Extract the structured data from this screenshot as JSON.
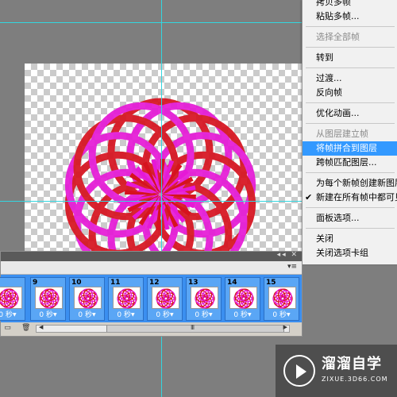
{
  "menu": {
    "items": [
      {
        "label": "拷贝多帧",
        "state": "normal"
      },
      {
        "label": "粘贴多帧...",
        "state": "normal"
      },
      {
        "label": "选择全部帧",
        "state": "disabled"
      },
      {
        "label": "转到",
        "state": "normal"
      },
      {
        "label": "过渡...",
        "state": "normal"
      },
      {
        "label": "反向帧",
        "state": "normal"
      },
      {
        "label": "优化动画...",
        "state": "normal"
      },
      {
        "label": "从图层建立帧",
        "state": "disabled"
      },
      {
        "label": "将帧拼合到图层",
        "state": "highlighted"
      },
      {
        "label": "跨帧匹配图层...",
        "state": "normal"
      },
      {
        "label": "为每个新帧创建新图层",
        "state": "normal"
      },
      {
        "label": "新建在所有帧中都可见",
        "state": "checked"
      },
      {
        "label": "面板选项...",
        "state": "normal"
      },
      {
        "label": "关闭",
        "state": "normal"
      },
      {
        "label": "关闭选项卡组",
        "state": "normal"
      }
    ],
    "check_glyph": "✔"
  },
  "animation_panel": {
    "collapse_glyph": "◂◂ ✕",
    "menu_glyph": "▾≡",
    "frames": [
      {
        "number": "",
        "delay": "0 秒"
      },
      {
        "number": "9",
        "delay": "0 秒"
      },
      {
        "number": "10",
        "delay": "0 秒"
      },
      {
        "number": "11",
        "delay": "0 秒"
      },
      {
        "number": "12",
        "delay": "0 秒"
      },
      {
        "number": "13",
        "delay": "0 秒"
      },
      {
        "number": "14",
        "delay": "0 秒"
      },
      {
        "number": "15",
        "delay": "0 秒"
      }
    ],
    "bottom_icons": [
      "new-frame-icon",
      "delete-frame-icon"
    ],
    "scroll_grip": "III"
  },
  "watermark": {
    "title": "溜溜自学",
    "subtitle": "ZIXUE.3D66.COM"
  },
  "colors": {
    "red": "#d6121e",
    "magenta": "#e619d6",
    "frames_bg": "#3b8ff0",
    "menu_highlight": "#3399ff"
  },
  "icons": {
    "frame_delay_arrow": "▼",
    "scroll_left": "◀",
    "scroll_right": "▶"
  }
}
